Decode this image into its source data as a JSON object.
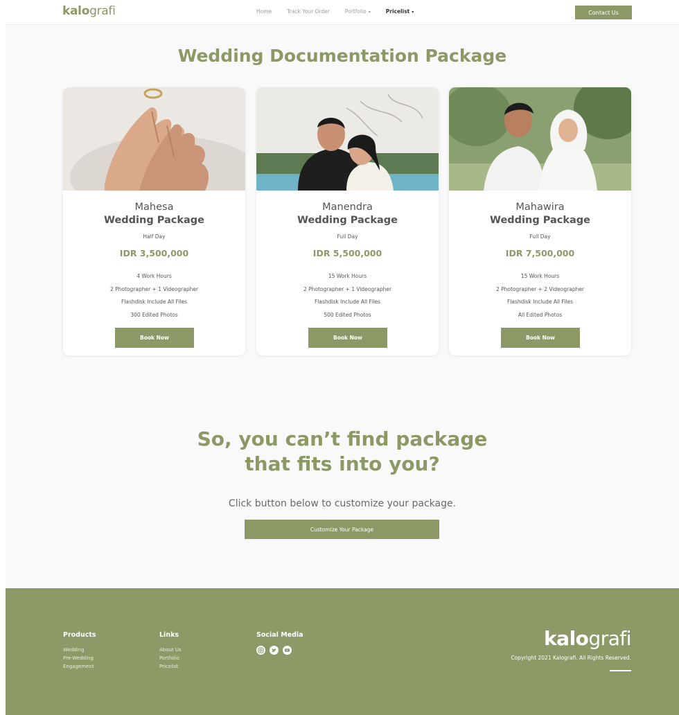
{
  "brand": {
    "bold": "kalo",
    "light": "grafi"
  },
  "nav": {
    "items": [
      {
        "label": "Home",
        "caret": ""
      },
      {
        "label": "Track Your Order",
        "caret": ""
      },
      {
        "label": "Portfolio",
        "caret": "▾"
      },
      {
        "label": "Pricelist",
        "caret": "▾"
      }
    ],
    "contact_label": "Contact Us"
  },
  "section_title": "Wedding Documentation Package",
  "packages": [
    {
      "name_line1": "Mahesa",
      "name_line2": "Wedding Package",
      "duration": "Half Day",
      "price": "IDR 3,500,000",
      "features": [
        "4 Work Hours",
        "2 Photographer + 1 Videographer",
        "Flashdisk Include All Files",
        "300 Edited Photos"
      ],
      "button": "Book Now",
      "image": "hands-with-ring-photo"
    },
    {
      "name_line1": "Manendra",
      "name_line2": "Wedding Package",
      "duration": "Full Day",
      "price": "IDR 5,500,000",
      "features": [
        "15 Work Hours",
        "2 Photographer + 1 Videographer",
        "Flashdisk Include All Files",
        "500 Edited Photos"
      ],
      "button": "Book Now",
      "image": "couple-by-pool-photo"
    },
    {
      "name_line1": "Mahawira",
      "name_line2": "Wedding Package",
      "duration": "Full Day",
      "price": "IDR 7,500,000",
      "features": [
        "15 Work Hours",
        "2 Photographer + 2 Videographer",
        "Flashdisk Include All Files",
        "All Edited Photos"
      ],
      "button": "Book Now",
      "image": "couple-in-garden-photo"
    }
  ],
  "cta": {
    "title_line1": "So, you can’t find package",
    "title_line2": "that fits into you?",
    "subtitle": "Click button below to customize your package.",
    "button": "Customize Your Package"
  },
  "footer": {
    "products": {
      "heading": "Products",
      "items": [
        "Wedding",
        "Pre-Wedding",
        "Engagement"
      ]
    },
    "links": {
      "heading": "Links",
      "items": [
        "About Us",
        "Portfolio",
        "Pricelist"
      ]
    },
    "social": {
      "heading": "Social Media",
      "icons": [
        "instagram-icon",
        "twitter-icon",
        "youtube-icon"
      ]
    },
    "copyright": "Copyright 2021 Kalografi. All Rights Reserved."
  },
  "colors": {
    "accent": "#8c9966",
    "footer_bg": "#8d9a68",
    "page_bg": "#f9f9f9"
  }
}
